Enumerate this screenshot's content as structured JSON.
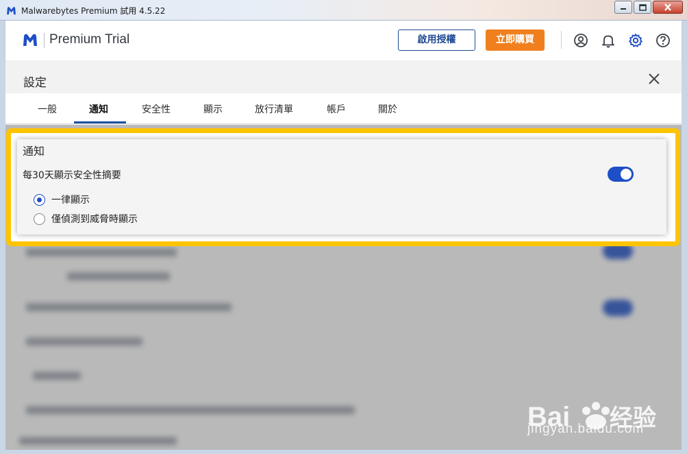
{
  "window": {
    "title": "Malwarebytes Premium 試用  4.5.22"
  },
  "header": {
    "brand": "Premium Trial",
    "activate_label": "啟用授權",
    "buy_label": "立即購買"
  },
  "settings": {
    "title": "設定",
    "tabs": [
      {
        "label": "一般"
      },
      {
        "label": "通知"
      },
      {
        "label": "安全性"
      },
      {
        "label": "顯示"
      },
      {
        "label": "放行清單"
      },
      {
        "label": "帳戶"
      },
      {
        "label": "關於"
      }
    ],
    "active_tab": "通知"
  },
  "notification": {
    "section_title": "通知",
    "summary_label": "每30天顯示安全性摘要",
    "summary_enabled": true,
    "options": [
      {
        "label": "一律顯示",
        "checked": true
      },
      {
        "label": "僅偵測到威脅時顯示",
        "checked": false
      }
    ]
  },
  "colors": {
    "accent": "#1d4fc6",
    "buy": "#f0801e",
    "highlight": "#ffc400"
  },
  "watermark": {
    "text": "jingyan.baidu.com"
  }
}
